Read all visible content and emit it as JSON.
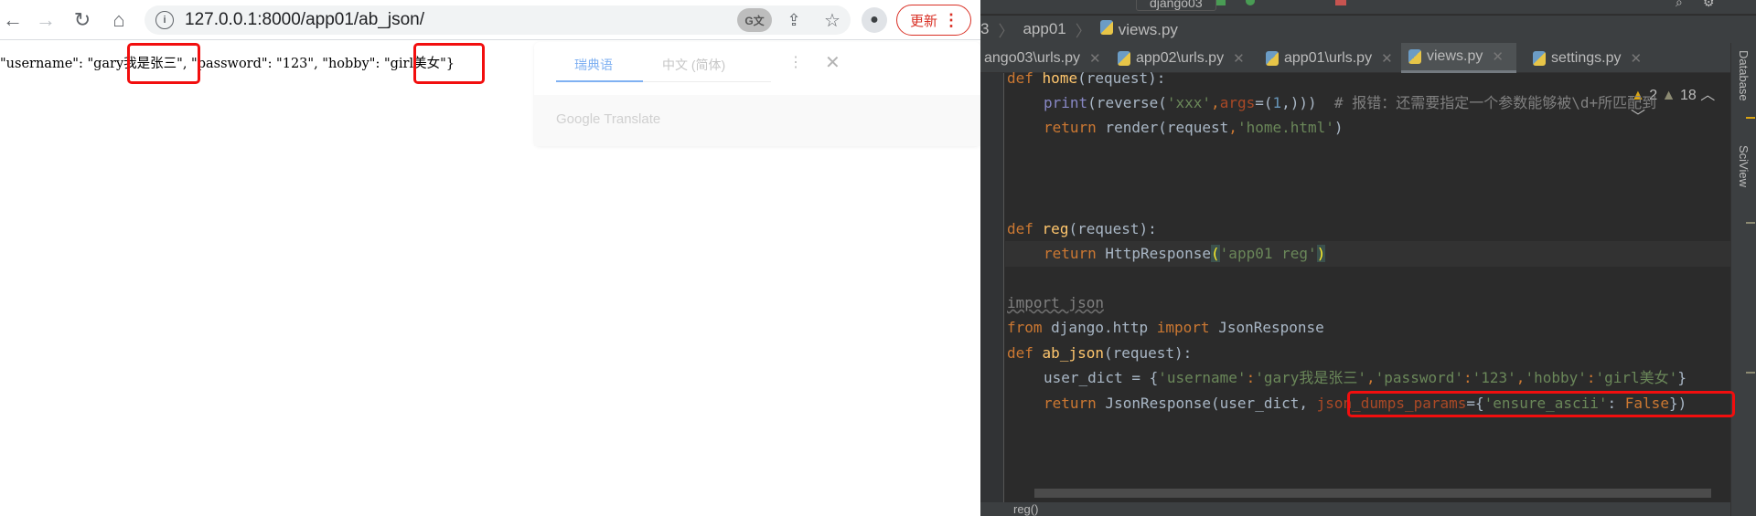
{
  "browser": {
    "url": "127.0.0.1:8000/app01/ab_json/",
    "update_label": "更新",
    "json_output": {
      "part1": "\"username\": \"gary",
      "highlight1": "我是张三\",",
      "part2": " \"password\": \"123\", \"hobby\": \"",
      "highlight2": "girl美女\"",
      "part3": "}"
    },
    "translate_popup": {
      "source_lang": "瑞典语",
      "target_lang": "中文 (简体)",
      "brand": "Google Translate"
    }
  },
  "ide": {
    "run_config": "django03",
    "breadcrumbs": [
      "3",
      "app01",
      "views.py"
    ],
    "tabs": [
      {
        "label": "ango03\\urls.py"
      },
      {
        "label": "app02\\urls.py"
      },
      {
        "label": "app01\\urls.py"
      },
      {
        "label": "views.py",
        "active": true
      },
      {
        "label": "settings.py"
      }
    ],
    "inspections": {
      "warnings": "2",
      "weak_warnings": "18"
    },
    "side_tools": [
      "Database",
      "SciView"
    ],
    "code": {
      "l1": {
        "kw": "def",
        "fn": "home",
        "rest": "(request):"
      },
      "l2": {
        "a": "print",
        "b": "(reverse(",
        "c": "'xxx'",
        "d": ",",
        "e": "args",
        "f": "=(",
        "g": "1",
        "h": ",)))",
        "comment": "  # 报错：还需要指定一个参数能够被\\d+所匹配到"
      },
      "l3": {
        "kw": "return",
        "rest": " render(request",
        "comma": ",",
        "str": "'home.html'",
        "end": ")"
      },
      "l4": {
        "kw": "def",
        "fn": "reg",
        "rest": "(request):"
      },
      "l5": {
        "kw": "return",
        "rest": " HttpResponse",
        "p1": "(",
        "str": "'app01 reg'",
        "p2": ")"
      },
      "l6": {
        "text": "import json"
      },
      "l7": {
        "kw1": "from",
        "mid": " django.http ",
        "kw2": "import",
        "rest": " JsonResponse"
      },
      "l8": {
        "kw": "def",
        "fn": "ab_json",
        "rest": "(request):"
      },
      "l9": {
        "a": "user_dict = {",
        "k1": "'username'",
        "c1": ":",
        "v1": "'gary我是张三'",
        "s1": ",",
        "k2": "'password'",
        "c2": ":",
        "v2": "'123'",
        "s2": ",",
        "k3": "'hobby'",
        "c3": ":",
        "v3": "'girl美女'",
        "end": "}"
      },
      "l10": {
        "kw": "return",
        "rest": " JsonResponse(user_dict, ",
        "param": "json_dumps_params",
        "eq": "={",
        "str": "'ensure_ascii'",
        "colon": ": ",
        "val": "False",
        "end": "})"
      }
    },
    "status_text": "reg()"
  }
}
